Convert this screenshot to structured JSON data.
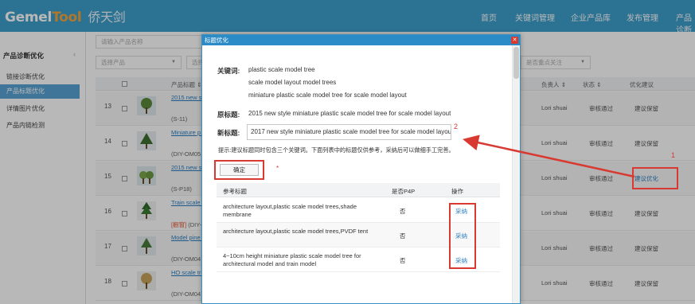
{
  "header": {
    "logo_main": "Gemel",
    "logo_accent": "Tool",
    "logo_cn": "侨天剑",
    "nav": [
      "首页",
      "关键词管理",
      "企业产品库",
      "发布管理",
      "产品诊断"
    ]
  },
  "sidebar": {
    "section": "产品诊断优化",
    "collapse": "‹",
    "items": [
      "链接诊断优化",
      "产品标题优化",
      "详情图片优化",
      "产品内链检测"
    ]
  },
  "filters": {
    "search_placeholder": "请输入产品名称",
    "select_product": "选择产品",
    "select_other": "选择",
    "focus": "是否重点关注"
  },
  "table": {
    "headers": {
      "title": "产品标题 ⇕",
      "owner": "负责人 ⇕",
      "status": "状态 ⇕",
      "suggest": "优化建议"
    },
    "rows": [
      {
        "n": "13",
        "title": "2015 new st Architectu",
        "code": "(S-11)",
        "tag": "",
        "owner": "Lori shuai",
        "status": "审核通过",
        "suggest": "建议保留"
      },
      {
        "n": "14",
        "title": "Miniature p tree(DIY-OM",
        "code": "(DIY-OM05",
        "tag": "",
        "owner": "Lori shuai",
        "status": "审核通过",
        "suggest": "建议保留"
      },
      {
        "n": "15",
        "title": "2015 new st scale mode",
        "code": "(S-P18)",
        "tag": "",
        "owner": "Lori shuai",
        "status": "审核通过",
        "suggest": "建议优化"
      },
      {
        "n": "16",
        "title": "Train scale OM027)",
        "code": "(DIY-",
        "tag": "[橱窗]",
        "owner": "Lori shuai",
        "status": "审核通过",
        "suggest": "建议保留"
      },
      {
        "n": "17",
        "title": "Model pine tree(DIY-OM",
        "code": "(DIY-OM04",
        "tag": "",
        "owner": "Lori shuai",
        "status": "审核通过",
        "suggest": "建议保留"
      },
      {
        "n": "18",
        "title": "HO scale tr tree(DIY-OM",
        "code": "(DIY-OM04",
        "tag": "",
        "owner": "Lori shuai",
        "status": "审核通过",
        "suggest": "建议保留"
      }
    ]
  },
  "dialog": {
    "title": "标题优化",
    "close": "✕",
    "keywords_label": "关键词:",
    "keywords": [
      "plastic scale model tree",
      "scale model layout model trees",
      "miniature plastic scale model tree for scale model layout"
    ],
    "orig_label": "原标题:",
    "orig_title": "2015 new style miniature plastic scale model tree for scale model layout",
    "new_label": "新标题:",
    "new_title": "2017 new style miniature plastic scale model tree for scale model layout",
    "tip": "提示:建议标题同时包含三个关键词。下面列表中的标题仅供参考，采纳后可以做细手工完善。",
    "confirm": "确定",
    "star": "*",
    "ref_headers": {
      "title": "参考标题",
      "p4p": "是否P4P",
      "op": "操作"
    },
    "refs": [
      {
        "title": "architecture layout,plastic scale model trees,shade membrane",
        "p4p": "否",
        "op": "采纳"
      },
      {
        "title": "architecture layout,plastic scale model trees,PVDF tent",
        "p4p": "否",
        "op": "采纳"
      },
      {
        "title": "4~10cm height miniature plastic scale model tree for architectural model and train model",
        "p4p": "否",
        "op": "采纳"
      }
    ]
  },
  "annotations": {
    "n1": "1",
    "n2": "2"
  }
}
